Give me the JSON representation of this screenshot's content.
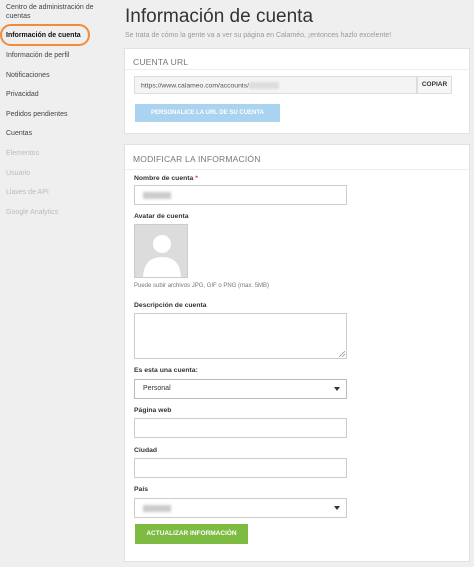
{
  "sidebar": {
    "items": [
      {
        "label": "Centro de administración de cuentas",
        "state": "normal"
      },
      {
        "label": "Información de cuenta",
        "state": "active"
      },
      {
        "label": "Información de perfil",
        "state": "normal"
      },
      {
        "label": "Notificaciones",
        "state": "normal"
      },
      {
        "label": "Privacidad",
        "state": "normal"
      },
      {
        "label": "Pedidos pendientes",
        "state": "normal"
      },
      {
        "label": "Cuentas",
        "state": "normal"
      },
      {
        "label": "Elementos",
        "state": "disabled"
      },
      {
        "label": "Usuario",
        "state": "disabled"
      },
      {
        "label": "Llaves de API",
        "state": "disabled"
      },
      {
        "label": "Google Analytics",
        "state": "disabled"
      }
    ]
  },
  "header": {
    "title": "Información de cuenta",
    "subtitle": "Se trata de cómo la gente va a ver su página en Calaméo, ¡entonces hazlo excelente!"
  },
  "url_card": {
    "title": "CUENTA URL",
    "url_prefix": "https://www.calameo.com/accounts/",
    "copy_label": "COPIAR",
    "personalize_label": "PERSONALICE LA URL DE SU CUENTA"
  },
  "info_card": {
    "title": "MODIFICAR LA INFORMACIÓN",
    "account_name_label": "Nombre de cuenta",
    "required_mark": "*",
    "avatar_label": "Avatar de cuenta",
    "avatar_hint": "Puede subir archivos JPG, GIF o PNG (max. 5MB)",
    "description_label": "Descripción de cuenta",
    "account_type_label": "Es esta una cuenta:",
    "account_type_value": "Personal",
    "website_label": "Página web",
    "city_label": "Ciudad",
    "country_label": "País",
    "update_label": "ACTUALIZAR INFORMACIÓN"
  },
  "colors": {
    "accent_highlight": "#f08c3a",
    "personalize_button": "#a9d3ef",
    "update_button": "#7dbb42"
  }
}
